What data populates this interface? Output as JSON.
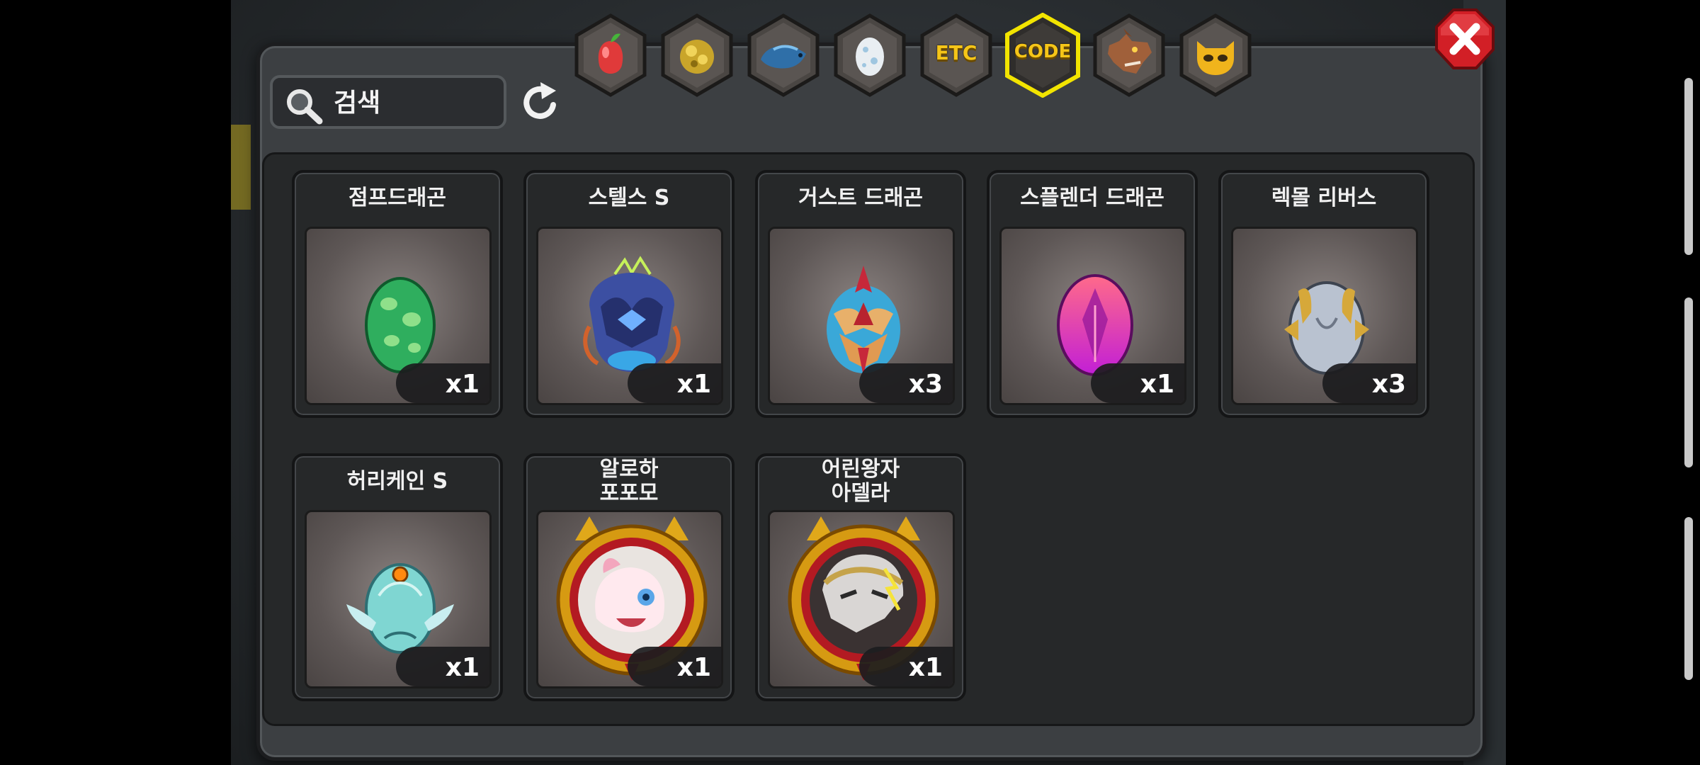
{
  "search": {
    "placeholder": "검색"
  },
  "tabs": [
    {
      "name": "fruit",
      "label": ""
    },
    {
      "name": "gold",
      "label": ""
    },
    {
      "name": "fish",
      "label": ""
    },
    {
      "name": "egg",
      "label": ""
    },
    {
      "name": "etc",
      "label": "ETC"
    },
    {
      "name": "code",
      "label": "CODE",
      "selected": true
    },
    {
      "name": "beast",
      "label": ""
    },
    {
      "name": "mask",
      "label": ""
    }
  ],
  "colors": {
    "tab_selected_border": "#f2e400",
    "tab_label": "#f5c518",
    "close_red": "#d21f26",
    "panel": "#3c3f42",
    "list_bg": "#262829"
  },
  "items": [
    {
      "name": "점프드래곤",
      "qty": "x1",
      "icon": "green-egg-icon"
    },
    {
      "name": "스텔스 S",
      "qty": "x1",
      "icon": "stealth-egg-icon"
    },
    {
      "name": "거스트 드래곤",
      "qty": "x3",
      "icon": "gust-dragon-egg-icon"
    },
    {
      "name": "스플렌더 드래곤",
      "qty": "x1",
      "icon": "pink-egg-icon"
    },
    {
      "name": "렉몰 리버스",
      "qty": "x3",
      "icon": "silver-egg-icon"
    },
    {
      "name": "허리케인 S",
      "qty": "x1",
      "icon": "hurricane-egg-icon"
    },
    {
      "name_line1": "알로하",
      "name_line2": "포포모",
      "qty": "x1",
      "icon": "popomo-portrait-icon"
    },
    {
      "name_line1": "어린왕자",
      "name_line2": "아델라",
      "qty": "x1",
      "icon": "adela-portrait-icon"
    }
  ]
}
